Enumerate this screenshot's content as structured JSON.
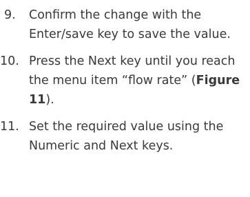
{
  "steps": [
    {
      "number": "9.",
      "text": "Confirm the change with the Enter/save key to save the value."
    },
    {
      "number": "10.",
      "text_before": "Press the Next key until you reach the menu item “flow rate” (",
      "bold": "Figure 11",
      "text_after": ")."
    },
    {
      "number": "11.",
      "text": "Set the required value using the Numeric and Next keys."
    }
  ]
}
